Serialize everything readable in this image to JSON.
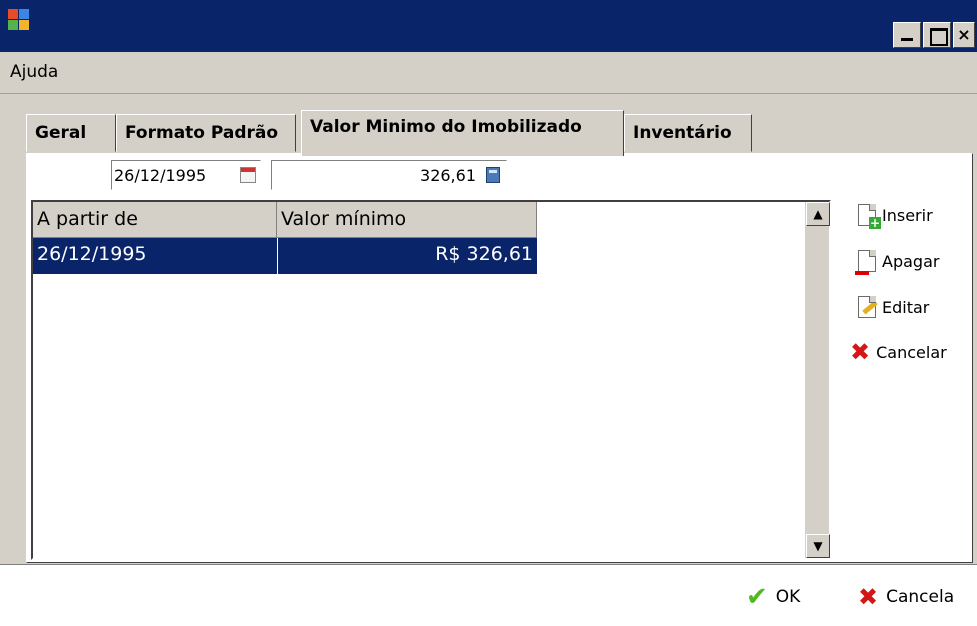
{
  "window": {
    "title": "",
    "controls": [
      "minimize-icon",
      "maximize-icon",
      "close-icon"
    ],
    "colors": {
      "titlebar": "#0a246a",
      "selection": "#0a246a",
      "surface": "#d4d0c8"
    }
  },
  "menu": {
    "items": [
      {
        "label": "Ajuda"
      }
    ]
  },
  "tabs": [
    {
      "label": "Geral"
    },
    {
      "label": "Formato Padrão"
    },
    {
      "label": "Valor Minimo do Imobilizado"
    },
    {
      "label": "Inventário"
    }
  ],
  "active_tab": "Valor Minimo do Imobilizado",
  "inputs": {
    "date": {
      "value": "26/12/1995",
      "icon": "calendar-icon"
    },
    "value": {
      "value": "326,61",
      "icon": "calculator-icon"
    }
  },
  "grid": {
    "columns": [
      {
        "label": "A partir de"
      },
      {
        "label": "Valor mínimo"
      }
    ],
    "rows": [
      {
        "date": "26/12/1995",
        "value": "R$ 326,61"
      }
    ],
    "scrollbar": {
      "up": "▲",
      "down": "▼"
    }
  },
  "actions": {
    "insert": {
      "label": "Inserir",
      "icon": "insert-file-icon"
    },
    "delete": {
      "label": "Apagar",
      "icon": "delete-file-icon"
    },
    "edit": {
      "label": "Editar",
      "icon": "edit-file-icon"
    },
    "cancel": {
      "label": "Cancelar",
      "icon": "cancel-icon"
    }
  },
  "footer": {
    "ok": {
      "label": "OK",
      "icon": "check-icon"
    },
    "cancel": {
      "label": "Cancela",
      "icon": "cancel-icon"
    }
  }
}
